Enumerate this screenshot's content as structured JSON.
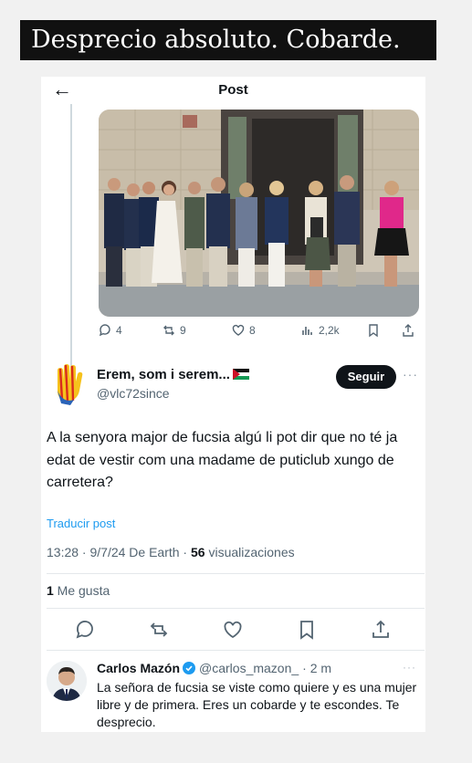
{
  "caption": "Desprecio absoluto. Cobarde.",
  "header": {
    "title": "Post",
    "back_icon": "arrow-left-icon"
  },
  "original_post": {
    "metrics": {
      "replies": "4",
      "reposts": "9",
      "likes": "8",
      "views": "2,2k"
    }
  },
  "reply": {
    "display_name": "Erem, som i serem...",
    "handle": "@vlc72since",
    "follow_label": "Seguir",
    "more_label": "···",
    "text": "A la senyora major de fucsia algú li pot dir que no té ja edat de vestir com una madame de puticlub xungo de carretera?",
    "translate_label": "Traducir post",
    "timestamp": "13:28 · 9/7/24 De Earth · ",
    "views_count": "56",
    "views_label": " visualizaciones",
    "likes_count": "1",
    "likes_label": " Me gusta"
  },
  "response": {
    "display_name": "Carlos Mazón",
    "handle": "@carlos_mazon_",
    "time": "· 2 m",
    "more_label": "···",
    "text": "La señora de fucsia se viste como quiere y es una mujer libre y de primera. Eres un cobarde y te escondes. Te desprecio."
  },
  "colors": {
    "accent": "#1d9bf0",
    "text": "#0f1419",
    "muted": "#536471",
    "fuchsia": "#e0288a"
  }
}
